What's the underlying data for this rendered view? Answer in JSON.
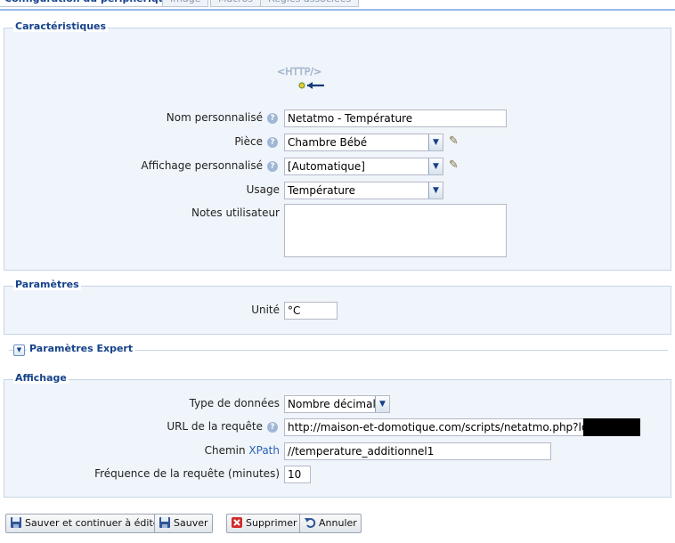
{
  "tabs": [
    {
      "label": "Configuration du périphérique",
      "active": true
    },
    {
      "label": "Image",
      "active": false
    },
    {
      "label": "Macros",
      "active": false
    },
    {
      "label": "Règles associées",
      "active": false
    }
  ],
  "caracteristiques": {
    "title": "Caractéristiques",
    "logo_text": "<HTTP/>",
    "fields": {
      "nom": {
        "label": "Nom personnalisé",
        "value": "Netatmo - Température"
      },
      "piece": {
        "label": "Pièce",
        "value": "Chambre Bébé"
      },
      "affichage": {
        "label": "Affichage personnalisé",
        "value": "[Automatique]"
      },
      "usage": {
        "label": "Usage",
        "value": "Température"
      },
      "notes": {
        "label": "Notes utilisateur",
        "value": ""
      }
    }
  },
  "parametres": {
    "title": "Paramètres",
    "unite": {
      "label": "Unité",
      "value": "°C"
    }
  },
  "expert": {
    "title": "Paramètres Expert"
  },
  "affichage": {
    "title": "Affichage",
    "type_donnees": {
      "label": "Type de données",
      "value": "Nombre décimal"
    },
    "url": {
      "label": "URL de la requête",
      "value": "http://maison-et-domotique.com/scripts/netatmo.php?login="
    },
    "chemin": {
      "label": "Chemin",
      "label_link": "XPath",
      "value": "//temperature_additionnel1"
    },
    "frequence": {
      "label": "Fréquence de la requête (minutes)",
      "value": "10"
    }
  },
  "buttons": {
    "save_continue": "Sauver et continuer à éditer",
    "save": "Sauver",
    "delete": "Supprimer",
    "cancel": "Annuler"
  },
  "icons": {
    "help": "question-circle-icon",
    "edit": "pencil-icon",
    "save": "floppy-disk-icon",
    "delete": "red-x-icon",
    "cancel": "undo-arrow-icon"
  },
  "colors": {
    "accent": "#15428b",
    "panel_bg": "#f0f5fb",
    "panel_border": "#c5d5e6"
  }
}
